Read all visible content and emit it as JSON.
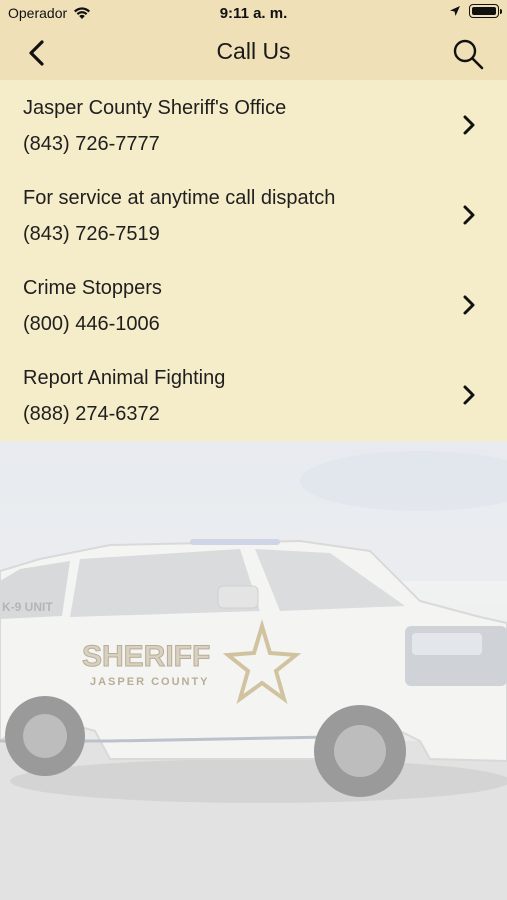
{
  "status_bar": {
    "carrier": "Operador",
    "time": "9:11 a. m."
  },
  "nav": {
    "title": "Call Us",
    "back_icon": "chevron-left-icon",
    "search_icon": "search-icon"
  },
  "contacts": [
    {
      "name": "Jasper County Sheriff's Office",
      "phone": "(843) 726-7777"
    },
    {
      "name": "For service at anytime call dispatch",
      "phone": "(843) 726-7519"
    },
    {
      "name": "Crime Stoppers",
      "phone": "(800) 446-1006"
    },
    {
      "name": "Report Animal Fighting",
      "phone": "(888) 274-6372"
    }
  ],
  "background_photo": {
    "vehicle_text": {
      "main": "SHERIFF",
      "county": "JASPER COUNTY",
      "unit": "K-9 UNIT"
    }
  },
  "colors": {
    "header_bg": "#efe0b8",
    "list_bg": "#f5ecc9",
    "text": "#1f1f1f"
  }
}
